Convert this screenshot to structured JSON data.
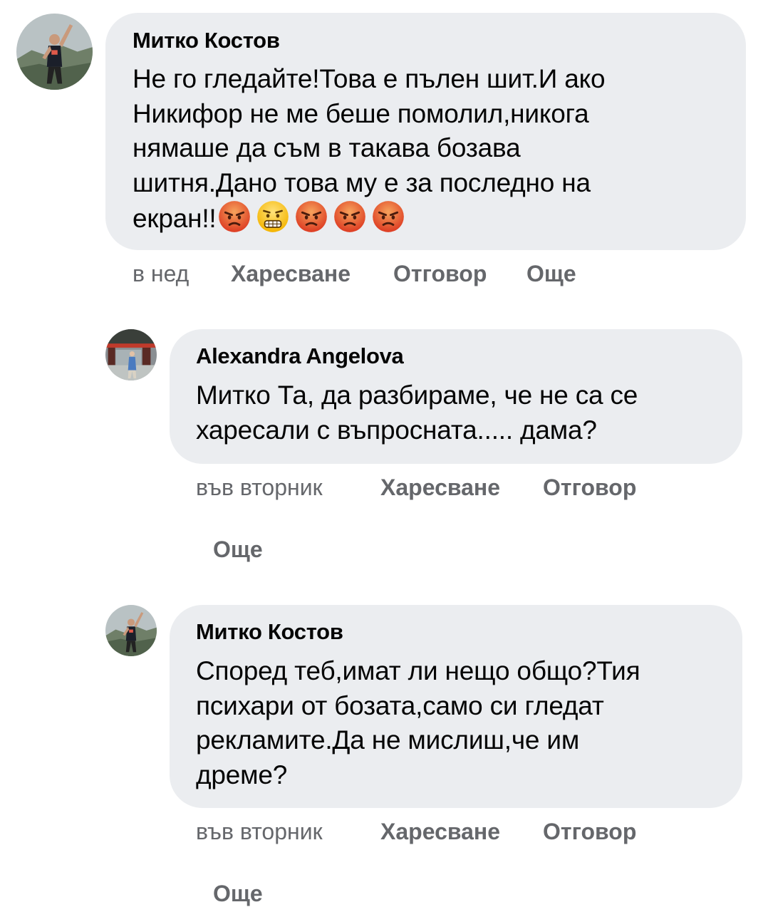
{
  "comments": [
    {
      "author": "Митко Костов",
      "lines": [
        "Не го гледайте!Това е пълен шит.И ако",
        "Никифор не ме беше помолил,никога",
        "нямаше да съм в такава бозава",
        "шитня.Дано това му е за последно на"
      ],
      "last_line": "екран!!",
      "emojis": [
        "angry-face-icon",
        "grimacing-face-icon",
        "angry-face-icon",
        "angry-face-icon",
        "angry-face-icon"
      ],
      "time": "в нед",
      "like": "Харесване",
      "reply": "Отговор",
      "more": "Още"
    },
    {
      "author": "Alexandra Angelova",
      "lines": [
        "Митко Та, да разбираме, че не са се",
        "харесали с въпросната..... дама?"
      ],
      "time": "във вторник",
      "like": "Харесване",
      "reply": "Отговор",
      "more": "Още"
    },
    {
      "author": "Митко Костов",
      "lines": [
        "Според теб,имат ли нещо общо?Тия",
        "психари от бозата,само си гледат",
        "рекламите.Да не мислиш,че им",
        "дреме?"
      ],
      "time": "във вторник",
      "like": "Харесване",
      "reply": "Отговор",
      "more": "Още"
    }
  ],
  "colors": {
    "bubble": "#ebedf0",
    "meta": "#65676b",
    "text": "#050505"
  }
}
